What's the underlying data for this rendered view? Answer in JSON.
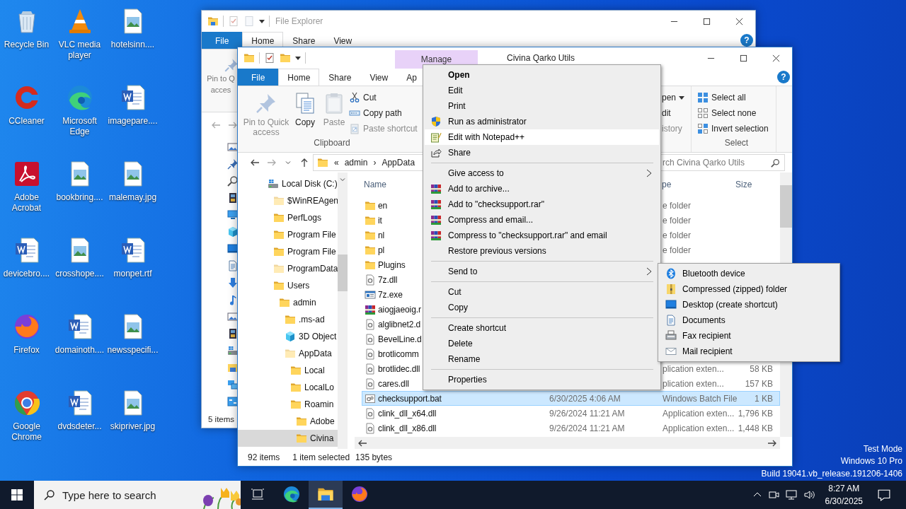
{
  "desktop_icons": [
    {
      "label": "Recycle Bin",
      "kind": "recycle"
    },
    {
      "label": "VLC media player",
      "kind": "vlc"
    },
    {
      "label": "hotelsinn....",
      "kind": "image"
    },
    {
      "label": "CCleaner",
      "kind": "ccleaner"
    },
    {
      "label": "Microsoft Edge",
      "kind": "edge"
    },
    {
      "label": "imagepare....",
      "kind": "word"
    },
    {
      "label": "Adobe Acrobat",
      "kind": "pdf"
    },
    {
      "label": "bookbring....",
      "kind": "image"
    },
    {
      "label": "malemay.jpg",
      "kind": "image"
    },
    {
      "label": "devicebro....",
      "kind": "word"
    },
    {
      "label": "crosshope....",
      "kind": "image"
    },
    {
      "label": "monpet.rtf",
      "kind": "word"
    },
    {
      "label": "Firefox",
      "kind": "firefox"
    },
    {
      "label": "domainoth....",
      "kind": "word"
    },
    {
      "label": "newsspecifi...",
      "kind": "image"
    },
    {
      "label": "Google Chrome",
      "kind": "chrome"
    },
    {
      "label": "dvdsdeter...",
      "kind": "word"
    },
    {
      "label": "skipriver.jpg",
      "kind": "image"
    }
  ],
  "back_window": {
    "title": "File Explorer",
    "help": "?",
    "tabs": [
      {
        "label": "File",
        "kind": "file",
        "selected": false
      },
      {
        "label": "Home",
        "kind": "tab",
        "selected": true
      },
      {
        "label": "Share",
        "kind": "tab",
        "selected": false
      },
      {
        "label": "View",
        "kind": "tab",
        "selected": false
      }
    ],
    "pin_lines": [
      "Pin to Q",
      "acces"
    ],
    "status": "5 items"
  },
  "front_window": {
    "contextual_tab": "Manage",
    "title": "Civina Qarko Utils",
    "help": "?",
    "tabs": [
      {
        "label": "File",
        "kind": "file",
        "selected": false
      },
      {
        "label": "Home",
        "kind": "tab",
        "selected": true
      },
      {
        "label": "Share",
        "kind": "tab",
        "selected": false
      },
      {
        "label": "View",
        "kind": "tab",
        "selected": false
      },
      {
        "label": "Ap",
        "kind": "tab",
        "selected": false
      }
    ],
    "clipboard": {
      "group_label": "Clipboard",
      "large": [
        {
          "label": "Pin to Quick access",
          "kind": "pin",
          "disabled": true
        },
        {
          "label": "Copy",
          "kind": "copy",
          "disabled": false
        },
        {
          "label": "Paste",
          "kind": "paste",
          "disabled": true
        }
      ],
      "small": [
        {
          "label": "Cut",
          "kind": "scissors",
          "disabled": false
        },
        {
          "label": "Copy path",
          "kind": "copypath",
          "disabled": false
        },
        {
          "label": "Paste shortcut",
          "kind": "pasteshortcut",
          "disabled": true
        }
      ]
    },
    "open_group": [
      {
        "label": "pen",
        "dropdown": true,
        "disabled": false
      },
      {
        "label": "dit",
        "dropdown": false,
        "disabled": false
      },
      {
        "label": "istory",
        "dropdown": false,
        "disabled": true
      }
    ],
    "select_group": {
      "group_label": "Select",
      "items": [
        {
          "label": "Select all",
          "kind": "selectall"
        },
        {
          "label": "Select none",
          "kind": "selectnone"
        },
        {
          "label": "Invert selection",
          "kind": "invert"
        }
      ]
    },
    "address": [
      "«",
      "admin",
      "›",
      "AppData"
    ],
    "search_placeholder": "rch Civina Qarko Utils",
    "tree": {
      "label": "Local Disk (C:)",
      "kind": "drive",
      "hidden": false,
      "selected": false,
      "children": [
        {
          "label": "$WinREAgen",
          "kind": "folder",
          "hidden": true,
          "selected": false
        },
        {
          "label": "PerfLogs",
          "kind": "folder",
          "hidden": false,
          "selected": false
        },
        {
          "label": "Program File",
          "kind": "folder",
          "hidden": false,
          "selected": false
        },
        {
          "label": "Program File",
          "kind": "folder",
          "hidden": false,
          "selected": false
        },
        {
          "label": "ProgramData",
          "kind": "folder",
          "hidden": true,
          "selected": false
        },
        {
          "label": "Users",
          "kind": "folder",
          "hidden": false,
          "selected": false,
          "children": [
            {
              "label": "admin",
              "kind": "folder",
              "hidden": false,
              "selected": false,
              "children": [
                {
                  "label": ".ms-ad",
                  "kind": "folder",
                  "hidden": false,
                  "selected": false
                },
                {
                  "label": "3D Object",
                  "kind": "cube",
                  "hidden": false,
                  "selected": false
                },
                {
                  "label": "AppData",
                  "kind": "folder",
                  "hidden": true,
                  "selected": false,
                  "children": [
                    {
                      "label": "Local",
                      "kind": "folder",
                      "hidden": false,
                      "selected": false
                    },
                    {
                      "label": "LocalLo",
                      "kind": "folder",
                      "hidden": false,
                      "selected": false
                    },
                    {
                      "label": "Roamin",
                      "kind": "folder",
                      "hidden": false,
                      "selected": false,
                      "children": [
                        {
                          "label": "Adobe",
                          "kind": "folder",
                          "hidden": false,
                          "selected": false
                        },
                        {
                          "label": "Civina",
                          "kind": "folder",
                          "hidden": false,
                          "selected": true
                        }
                      ]
                    }
                  ]
                }
              ]
            }
          ]
        }
      ]
    },
    "columns": [
      "Name",
      "pe",
      "Size"
    ],
    "files": [
      {
        "name": "en",
        "kind": "folder",
        "type": "e folder",
        "selected": false
      },
      {
        "name": "it",
        "kind": "folder",
        "type": "e folder",
        "selected": false
      },
      {
        "name": "nl",
        "kind": "folder",
        "type": "e folder",
        "selected": false
      },
      {
        "name": "pl",
        "kind": "folder",
        "type": "e folder",
        "selected": false
      },
      {
        "name": "Plugins",
        "kind": "folder",
        "selected": false
      },
      {
        "name": "7z.dll",
        "kind": "dll",
        "selected": false
      },
      {
        "name": "7z.exe",
        "kind": "exe",
        "selected": false
      },
      {
        "name": "aiogjaeoig.r",
        "kind": "archive",
        "selected": false
      },
      {
        "name": "alglibnet2.d",
        "kind": "dll",
        "selected": false
      },
      {
        "name": "BevelLine.d",
        "kind": "dll",
        "selected": false
      },
      {
        "name": "brotlicomm",
        "kind": "dll",
        "selected": false
      },
      {
        "name": "brotlidec.dll",
        "kind": "dll",
        "type": "plication exten...",
        "size": "58 KB",
        "selected": false
      },
      {
        "name": "cares.dll",
        "kind": "dll",
        "type": "plication exten...",
        "size": "157 KB",
        "selected": false
      },
      {
        "name": "checksupport.bat",
        "kind": "bat",
        "date": "6/30/2025 4:06 AM",
        "type": "Windows Batch File",
        "size": "1 KB",
        "selected": true
      },
      {
        "name": "clink_dll_x64.dll",
        "kind": "dll",
        "date": "9/26/2024 11:21 AM",
        "type": "Application exten...",
        "size": "1,796 KB",
        "selected": false
      },
      {
        "name": "clink_dll_x86.dll",
        "kind": "dll",
        "date": "9/26/2024 11:21 AM",
        "type": "Application exten...",
        "size": "1,448 KB",
        "selected": false
      }
    ],
    "status": [
      "92 items",
      "1 item selected",
      "135 bytes"
    ]
  },
  "context_menu": {
    "groups": [
      [
        {
          "label": "Open",
          "kind": "plain",
          "default": true,
          "highlighted": false,
          "submenu": false
        },
        {
          "label": "Edit",
          "kind": "plain",
          "default": false,
          "highlighted": false,
          "submenu": false
        },
        {
          "label": "Print",
          "kind": "plain",
          "default": false,
          "highlighted": false,
          "submenu": false
        },
        {
          "label": "Run as administrator",
          "kind": "shield",
          "default": false,
          "highlighted": false,
          "submenu": false
        },
        {
          "label": "Edit with Notepad++",
          "kind": "notepad",
          "default": false,
          "highlighted": true,
          "submenu": false
        },
        {
          "label": "Share",
          "kind": "share",
          "default": false,
          "highlighted": false,
          "submenu": false
        }
      ],
      [
        {
          "label": "Give access to",
          "kind": "plain",
          "default": false,
          "highlighted": false,
          "submenu": true
        },
        {
          "label": "Add to archive...",
          "kind": "archive",
          "default": false,
          "highlighted": false,
          "submenu": false
        },
        {
          "label": "Add to \"checksupport.rar\"",
          "kind": "archive",
          "default": false,
          "highlighted": false,
          "submenu": false
        },
        {
          "label": "Compress and email...",
          "kind": "archive",
          "default": false,
          "highlighted": false,
          "submenu": false
        },
        {
          "label": "Compress to \"checksupport.rar\" and email",
          "kind": "archive",
          "default": false,
          "highlighted": false,
          "submenu": false
        },
        {
          "label": "Restore previous versions",
          "kind": "plain",
          "default": false,
          "highlighted": false,
          "submenu": false
        }
      ],
      [
        {
          "label": "Send to",
          "kind": "plain",
          "default": false,
          "highlighted": false,
          "submenu": true
        }
      ],
      [
        {
          "label": "Cut",
          "kind": "plain",
          "default": false,
          "highlighted": false,
          "submenu": false
        },
        {
          "label": "Copy",
          "kind": "plain",
          "default": false,
          "highlighted": false,
          "submenu": false
        }
      ],
      [
        {
          "label": "Create shortcut",
          "kind": "plain",
          "default": false,
          "highlighted": false,
          "submenu": false
        },
        {
          "label": "Delete",
          "kind": "plain",
          "default": false,
          "highlighted": false,
          "submenu": false
        },
        {
          "label": "Rename",
          "kind": "plain",
          "default": false,
          "highlighted": false,
          "submenu": false
        }
      ],
      [
        {
          "label": "Properties",
          "kind": "plain",
          "default": false,
          "highlighted": false,
          "submenu": false
        }
      ]
    ]
  },
  "send_to_menu": {
    "items": [
      {
        "label": "Bluetooth device",
        "kind": "bluetooth"
      },
      {
        "label": "Compressed (zipped) folder",
        "kind": "zip"
      },
      {
        "label": "Desktop (create shortcut)",
        "kind": "desktop"
      },
      {
        "label": "Documents",
        "kind": "documents"
      },
      {
        "label": "Fax recipient",
        "kind": "fax"
      },
      {
        "label": "Mail recipient",
        "kind": "mail"
      }
    ]
  },
  "system_text": [
    "Test Mode",
    "Windows 10 Pro",
    "Build 19041.vb_release.191206-1406"
  ],
  "taskbar": {
    "search_placeholder": "Type here to search",
    "apps": [
      {
        "kind": "taskview",
        "selected": false
      },
      {
        "kind": "edge",
        "selected": false
      },
      {
        "kind": "explorer",
        "selected": true
      },
      {
        "kind": "firefox",
        "selected": false
      }
    ],
    "time": "8:27 AM",
    "date": "6/30/2025"
  }
}
